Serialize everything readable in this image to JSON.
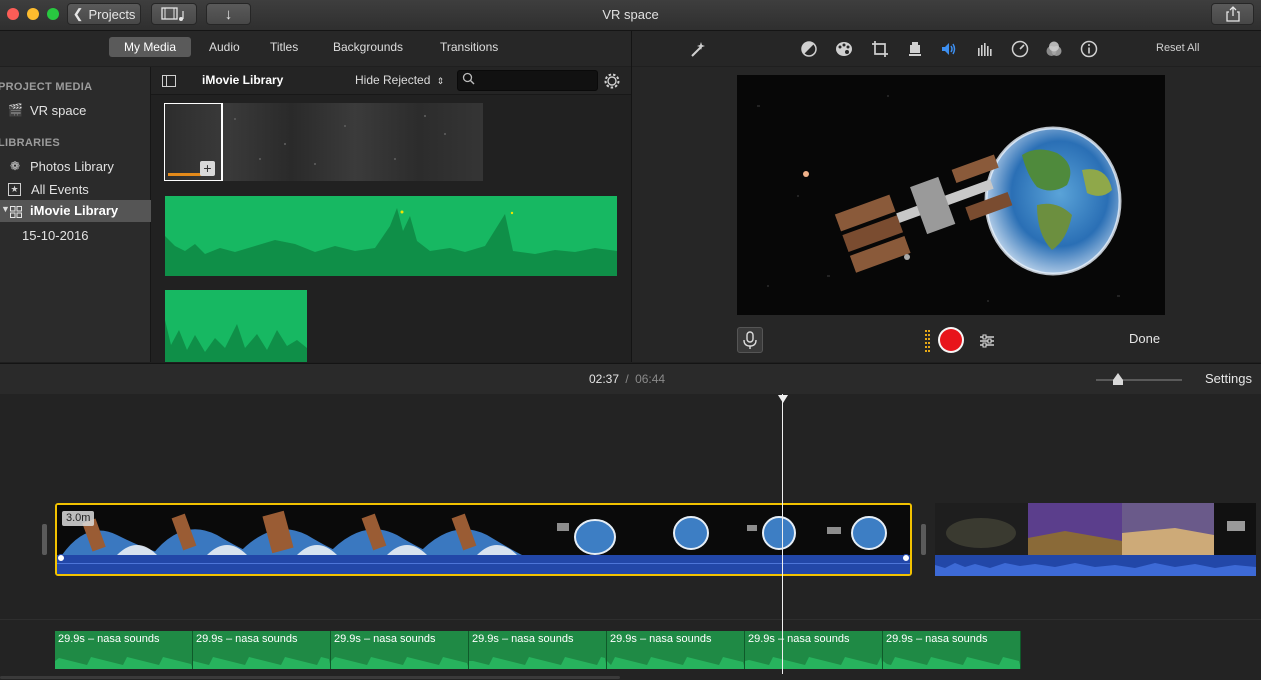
{
  "window": {
    "title": "VR space"
  },
  "toolbar": {
    "projects_label": "Projects"
  },
  "browser_tabs": [
    "My Media",
    "Audio",
    "Titles",
    "Backgrounds",
    "Transitions"
  ],
  "sidebar": {
    "project_media_header": "PROJECT MEDIA",
    "project_item": "VR space",
    "libraries_header": "LIBRARIES",
    "items": [
      "Photos Library",
      "All Events",
      "iMovie Library"
    ],
    "event": "15-10-2016"
  },
  "media": {
    "library_title": "iMovie Library",
    "filter_label": "Hide Rejected",
    "search_placeholder": ""
  },
  "viewer": {
    "reset_label": "Reset All",
    "done_label": "Done",
    "icons": [
      "magic-wand-icon",
      "color-balance-icon",
      "color-palette-icon",
      "crop-icon",
      "stabilization-icon",
      "volume-icon",
      "equalizer-icon",
      "speed-icon",
      "filter-icon",
      "info-icon"
    ]
  },
  "timeline": {
    "current_time": "02:37",
    "separator": "/",
    "total_time": "06:44",
    "settings_label": "Settings",
    "zoom_level": 0.25,
    "clip_duration_badge": "3.0m",
    "audio_clips": [
      "29.9s – nasa sounds",
      "29.9s – nasa sounds",
      "29.9s – nasa sounds",
      "29.9s – nasa sounds",
      "29.9s – nasa sounds",
      "29.9s – nasa sounds",
      "29.9s – nasa sounds"
    ]
  },
  "colors": {
    "accent_selection": "#f2c200",
    "audio_green": "#1f8a45",
    "clip_audio_blue": "#2247a8",
    "record_red": "#e8141b"
  }
}
